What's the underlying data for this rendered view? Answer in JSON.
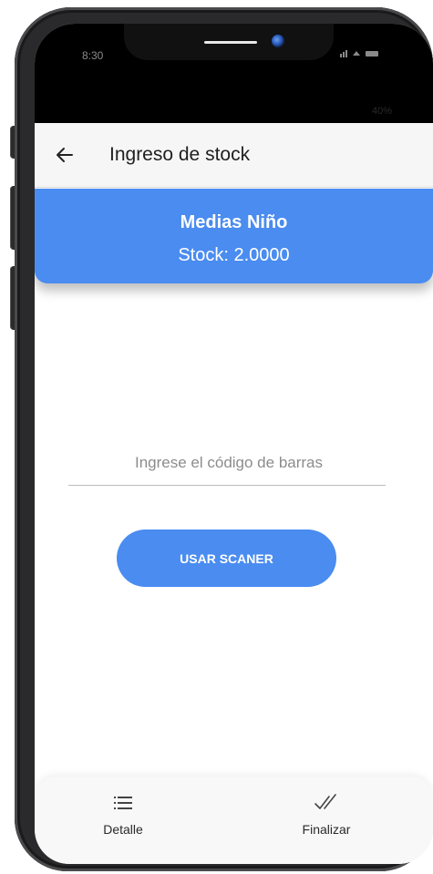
{
  "status_bar": {
    "time": "8:30",
    "battery": "40%"
  },
  "app_bar": {
    "title": "Ingreso de stock",
    "back_icon": "arrow-left-icon"
  },
  "product": {
    "name": "Medias Niño",
    "stock": "Stock: 2.0000"
  },
  "barcode": {
    "placeholder": "Ingrese el código de barras",
    "value": ""
  },
  "scan_button": {
    "label": "USAR SCANER"
  },
  "bottom_nav": {
    "items": [
      {
        "label": "Detalle",
        "icon": "list-icon"
      },
      {
        "label": "Finalizar",
        "icon": "double-check-icon"
      }
    ]
  },
  "colors": {
    "accent": "#4a8cf0",
    "appbar": "#f6f6f6",
    "phone_frame": "#2a2a2c"
  }
}
